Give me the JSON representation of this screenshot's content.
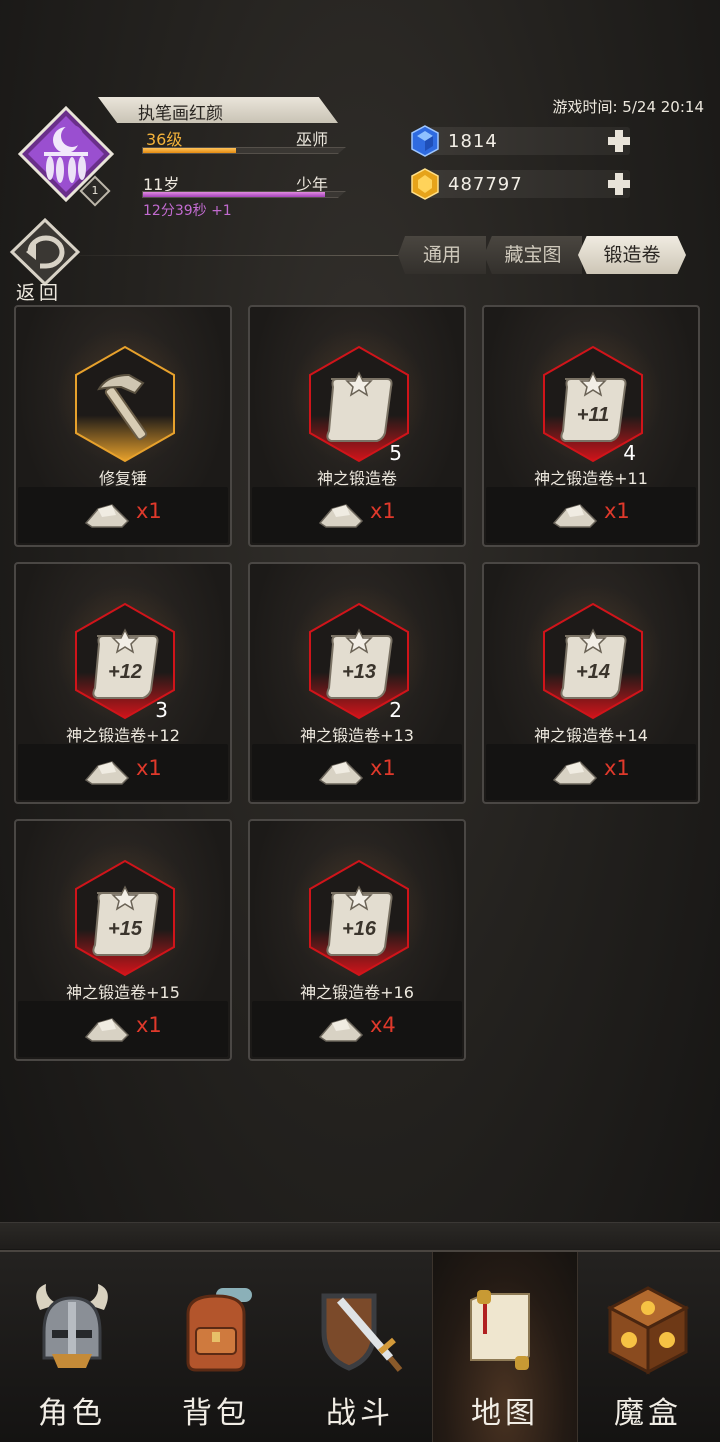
{
  "header": {
    "player_name": "执笔画红颜",
    "avatar_level": "1",
    "level_label": "36级",
    "class_label": "巫师",
    "level_progress": 0.46,
    "age_label": "11岁",
    "life_stage": "少年",
    "age_progress": 0.9,
    "timer_text": "12分39秒 +1",
    "game_time": "游戏时间: 5/24 20:14",
    "currencies": {
      "gems": "1814",
      "gold": "487797"
    }
  },
  "nav_back": {
    "label": "返回"
  },
  "tabs": [
    {
      "label": "通用",
      "active": false
    },
    {
      "label": "藏宝图",
      "active": false
    },
    {
      "label": "锻造卷",
      "active": true
    }
  ],
  "items": [
    {
      "name": "修复锤",
      "count": "",
      "cost": "x1",
      "icon": "hammer-icon"
    },
    {
      "name": "神之锻造卷",
      "count": "5",
      "cost": "x1",
      "icon": "scroll-icon"
    },
    {
      "name": "神之锻造卷+11",
      "count": "4",
      "cost": "x1",
      "icon": "scroll-icon",
      "scroll_label": "+11"
    },
    {
      "name": "神之锻造卷+12",
      "count": "3",
      "cost": "x1",
      "icon": "scroll-icon",
      "scroll_label": "+12"
    },
    {
      "name": "神之锻造卷+13",
      "count": "2",
      "cost": "x1",
      "icon": "scroll-icon",
      "scroll_label": "+13"
    },
    {
      "name": "神之锻造卷+14",
      "count": "",
      "cost": "x1",
      "icon": "scroll-icon",
      "scroll_label": "+14"
    },
    {
      "name": "神之锻造卷+15",
      "count": "",
      "cost": "x1",
      "icon": "scroll-icon",
      "scroll_label": "+15"
    },
    {
      "name": "神之锻造卷+16",
      "count": "",
      "cost": "x4",
      "icon": "scroll-icon",
      "scroll_label": "+16"
    }
  ],
  "bottom_nav": [
    {
      "label": "角色",
      "icon": "helmet-icon",
      "active": false
    },
    {
      "label": "背包",
      "icon": "backpack-icon",
      "active": false
    },
    {
      "label": "战斗",
      "icon": "sword-shield-icon",
      "active": false
    },
    {
      "label": "地图",
      "icon": "map-scroll-icon",
      "active": true
    },
    {
      "label": "魔盒",
      "icon": "magic-box-icon",
      "active": false
    }
  ],
  "colors": {
    "accent_gold": "#f3b23a",
    "accent_purple": "#a441b9",
    "cost_red": "#e0392b",
    "scroll_hex_red": "#d0141a",
    "hammer_hex_gold": "#e7a12c"
  }
}
